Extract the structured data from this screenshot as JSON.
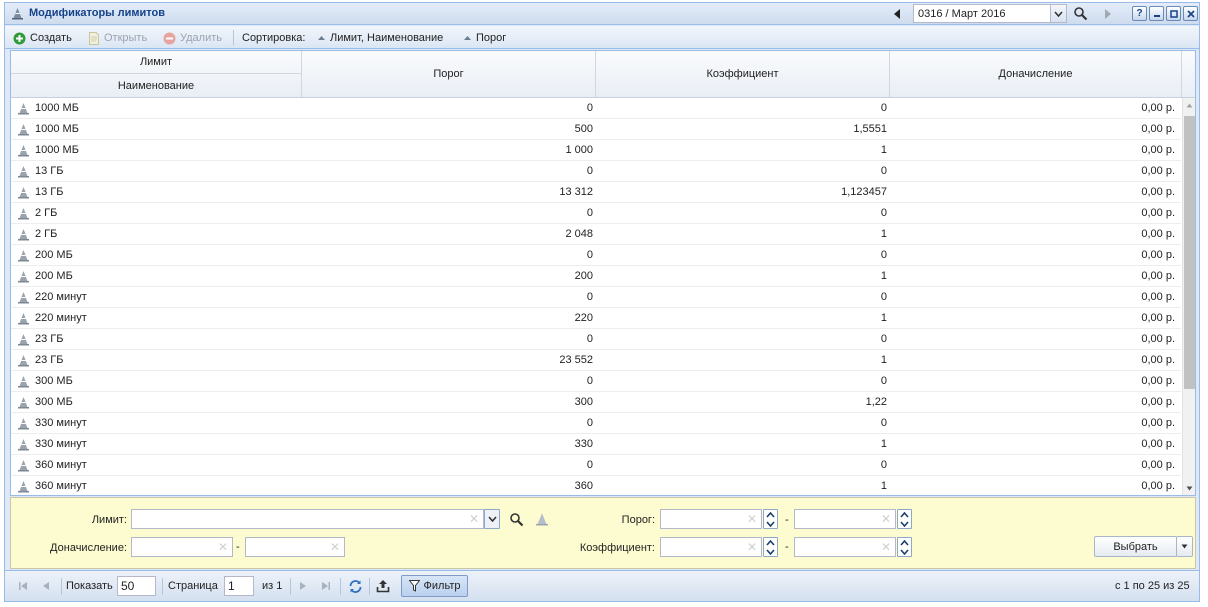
{
  "window": {
    "title": "Модификаторы лимитов",
    "period": "0316 / Март 2016"
  },
  "toolbar": {
    "create": "Создать",
    "open": "Открыть",
    "delete": "Удалить",
    "sort_label": "Сортировка:",
    "sort1": "Лимит, Наименование",
    "sort2": "Порог"
  },
  "grid": {
    "header": {
      "group": "Лимит",
      "name": "Наименование",
      "porog": "Порог",
      "koef": "Коэффициент",
      "don": "Доначисление"
    },
    "rows": [
      {
        "name": "1000 МБ",
        "porog": "0",
        "koef": "0",
        "don": "0,00 р."
      },
      {
        "name": "1000 МБ",
        "porog": "500",
        "koef": "1,5551",
        "don": "0,00 р."
      },
      {
        "name": "1000 МБ",
        "porog": "1 000",
        "koef": "1",
        "don": "0,00 р."
      },
      {
        "name": "13 ГБ",
        "porog": "0",
        "koef": "0",
        "don": "0,00 р."
      },
      {
        "name": "13 ГБ",
        "porog": "13 312",
        "koef": "1,123457",
        "don": "0,00 р."
      },
      {
        "name": "2 ГБ",
        "porog": "0",
        "koef": "0",
        "don": "0,00 р."
      },
      {
        "name": "2 ГБ",
        "porog": "2 048",
        "koef": "1",
        "don": "0,00 р."
      },
      {
        "name": "200 МБ",
        "porog": "0",
        "koef": "0",
        "don": "0,00 р."
      },
      {
        "name": "200 МБ",
        "porog": "200",
        "koef": "1",
        "don": "0,00 р."
      },
      {
        "name": "220 минут",
        "porog": "0",
        "koef": "0",
        "don": "0,00 р."
      },
      {
        "name": "220 минут",
        "porog": "220",
        "koef": "1",
        "don": "0,00 р."
      },
      {
        "name": "23 ГБ",
        "porog": "0",
        "koef": "0",
        "don": "0,00 р."
      },
      {
        "name": "23 ГБ",
        "porog": "23 552",
        "koef": "1",
        "don": "0,00 р."
      },
      {
        "name": "300 МБ",
        "porog": "0",
        "koef": "0",
        "don": "0,00 р."
      },
      {
        "name": "300 МБ",
        "porog": "300",
        "koef": "1,22",
        "don": "0,00 р."
      },
      {
        "name": "330 минут",
        "porog": "0",
        "koef": "0",
        "don": "0,00 р."
      },
      {
        "name": "330 минут",
        "porog": "330",
        "koef": "1",
        "don": "0,00 р."
      },
      {
        "name": "360 минут",
        "porog": "0",
        "koef": "0",
        "don": "0,00 р."
      },
      {
        "name": "360 минут",
        "porog": "360",
        "koef": "1",
        "don": "0,00 р."
      }
    ]
  },
  "filter": {
    "limit_label": "Лимит:",
    "limit_value": "",
    "don_label": "Доначисление:",
    "don_from": "",
    "don_to": "",
    "porog_label": "Порог:",
    "porog_from": "",
    "porog_to": "",
    "koef_label": "Коэффициент:",
    "koef_from": "",
    "koef_to": "",
    "dash": "-",
    "select_button": "Выбрать"
  },
  "paging": {
    "show_label": "Показать",
    "page_size": "50",
    "page_label": "Страница",
    "page": "1",
    "of_label": "из 1",
    "filter_button": "Фильтр",
    "summary": "с 1 по 25 из 25"
  },
  "colors": {
    "title_text": "#15428b",
    "create_icon": "#2f9b3a",
    "delete_icon": "#d9534f",
    "filter_bg": "#fdfcd0"
  }
}
